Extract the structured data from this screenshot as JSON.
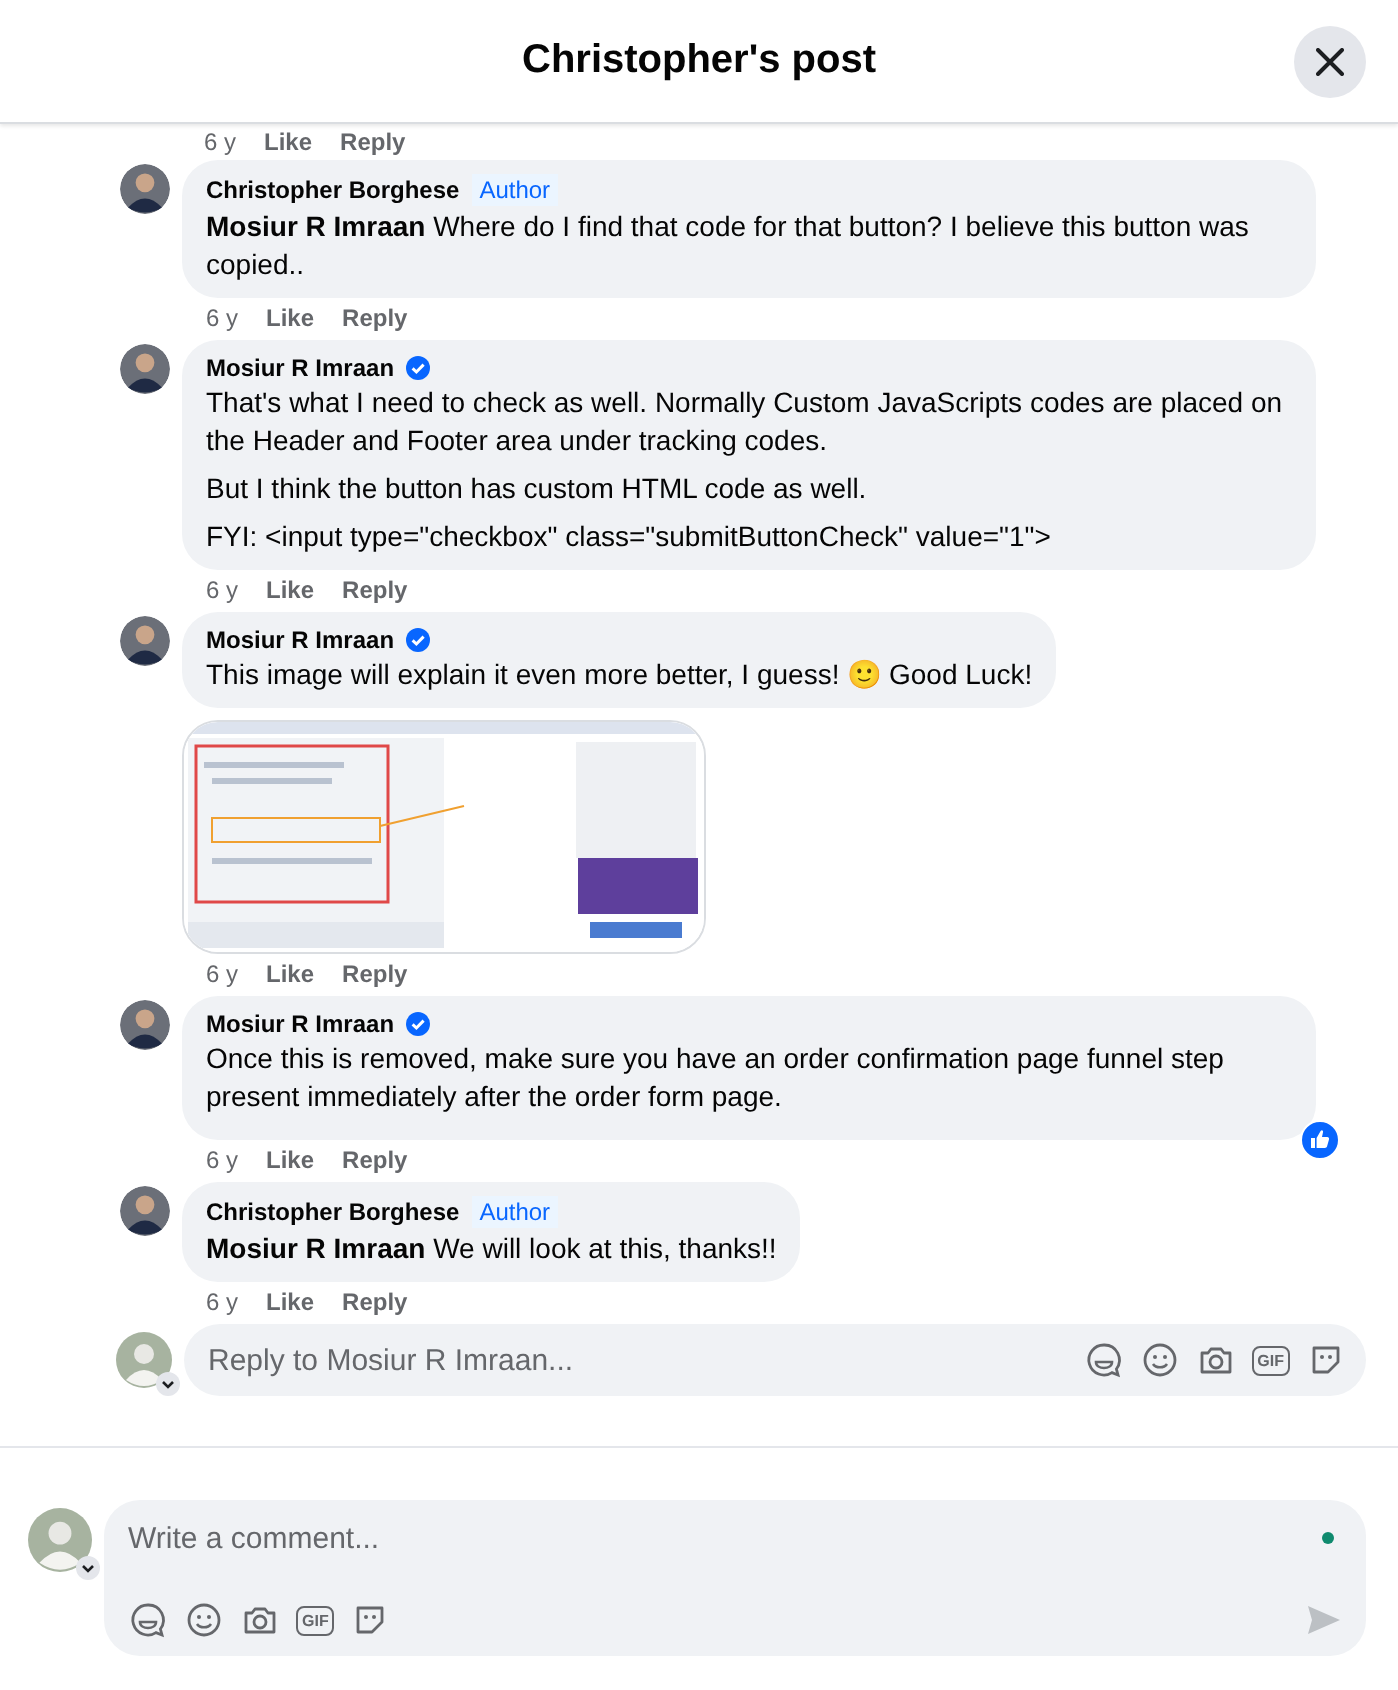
{
  "header": {
    "title": "Christopher's post"
  },
  "top_meta": {
    "time": "6 y",
    "like": "Like",
    "reply": "Reply"
  },
  "comments": [
    {
      "author": "Christopher Borghese",
      "badge": "Author",
      "verified": false,
      "paragraphs": [
        "**Mosiur R Imraan** Where do I find that code for that button? I believe this button was copied.."
      ],
      "liked": false,
      "time": "6 y",
      "like": "Like",
      "reply": "Reply"
    },
    {
      "author": "Mosiur R Imraan",
      "verified": true,
      "paragraphs": [
        "That's what I need to check as well. Normally Custom JavaScripts codes are placed on the Header and Footer area under tracking codes.",
        "But I think the button has custom HTML code as well.",
        "FYI: <input type=\"checkbox\" class=\"submitButtonCheck\" value=\"1\">"
      ],
      "liked": false,
      "time": "6 y",
      "like": "Like",
      "reply": "Reply"
    },
    {
      "author": "Mosiur R Imraan",
      "verified": true,
      "paragraphs": [
        "This image will explain it even more better, I guess! 🙂 Good Luck!"
      ],
      "liked": false,
      "time": "6 y",
      "like": "Like",
      "reply": "Reply"
    },
    {
      "author": "Mosiur R Imraan",
      "verified": true,
      "paragraphs": [
        "Once this is removed, make sure you have an order confirmation page funnel step present immediately after the order form page."
      ],
      "liked": true,
      "time": "6 y",
      "like": "Like",
      "reply": "Reply"
    },
    {
      "author": "Christopher Borghese",
      "badge": "Author",
      "verified": false,
      "paragraphs": [
        "**Mosiur R Imraan** We will look at this, thanks!!"
      ],
      "liked": false,
      "time": "6 y",
      "like": "Like",
      "reply": "Reply"
    }
  ],
  "reply_box": {
    "placeholder": "Reply to Mosiur R Imraan...",
    "gif": "GIF"
  },
  "composer": {
    "placeholder": "Write a comment...",
    "online": true,
    "gif": "GIF"
  }
}
